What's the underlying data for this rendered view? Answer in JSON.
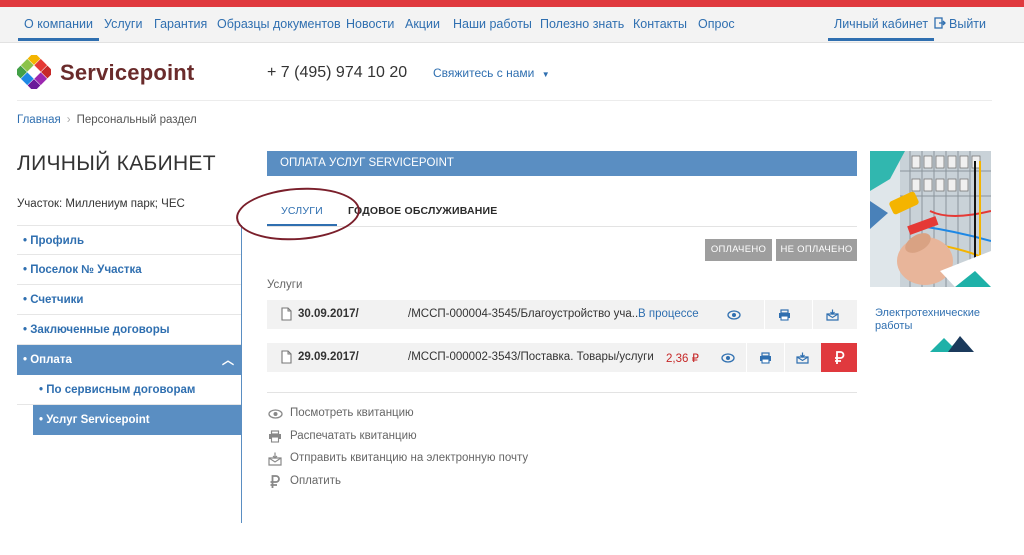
{
  "nav": {
    "items": [
      "О компании",
      "Услуги",
      "Гарантия",
      "Образцы документов",
      "Новости",
      "Акции",
      "Наши работы",
      "Полезно знать",
      "Контакты",
      "Опрос"
    ],
    "account": "Личный кабинет",
    "logout": "Выйти"
  },
  "header": {
    "brand": "Servicepoint",
    "phone": "+ 7 (495) 974 10 20",
    "contact": "Свяжитесь с нами"
  },
  "breadcrumb": {
    "home": "Главная",
    "current": "Персональный раздел"
  },
  "page_title": "ЛИЧНЫЙ КАБИНЕТ",
  "uchastok": "Участок: Миллениум парк; ЧЕС",
  "sidebar": {
    "items": [
      "• Профиль",
      "• Поселок № Участка",
      "• Счетчики",
      "• Заключенные договоры",
      "• Оплата"
    ],
    "subitems": [
      "• По сервисным договорам",
      "• Услуг Servicepoint"
    ]
  },
  "panel": {
    "title": "ОПЛАТА УСЛУГ SERVICEPOINT",
    "tabs": [
      "УСЛУГИ",
      "ГОДОВОЕ ОБСЛУЖИВАНИЕ"
    ],
    "filters": [
      "ОПЛАЧЕНО",
      "НЕ ОПЛАЧЕНО"
    ],
    "section_label": "Услуги",
    "rows": [
      {
        "date": "30.09.2017/",
        "number": "/МССП-000004-3545/Благоустройство уча...",
        "status": "В процессе",
        "amount": ""
      },
      {
        "date": "29.09.2017/",
        "number": "/МССП-000002-3543/Поставка. Товары/услуги",
        "status": "",
        "amount": "2,36 ₽"
      }
    ]
  },
  "legend": [
    {
      "icon": "eye-icon",
      "text": "Посмотреть квитанцию"
    },
    {
      "icon": "printer-icon",
      "text": "Распечатать квитанцию"
    },
    {
      "icon": "mail-icon",
      "text": "Отправить квитанцию на электронную почту"
    },
    {
      "icon": "ruble-icon",
      "text": "Оплатить"
    }
  ],
  "banner": {
    "caption_line1": "Электротехнические",
    "caption_line2": "работы"
  },
  "colors": {
    "accent": "#2f6fb0",
    "panel": "#5a8ec2",
    "red": "#e0393e",
    "brand": "#6a2b2b"
  }
}
